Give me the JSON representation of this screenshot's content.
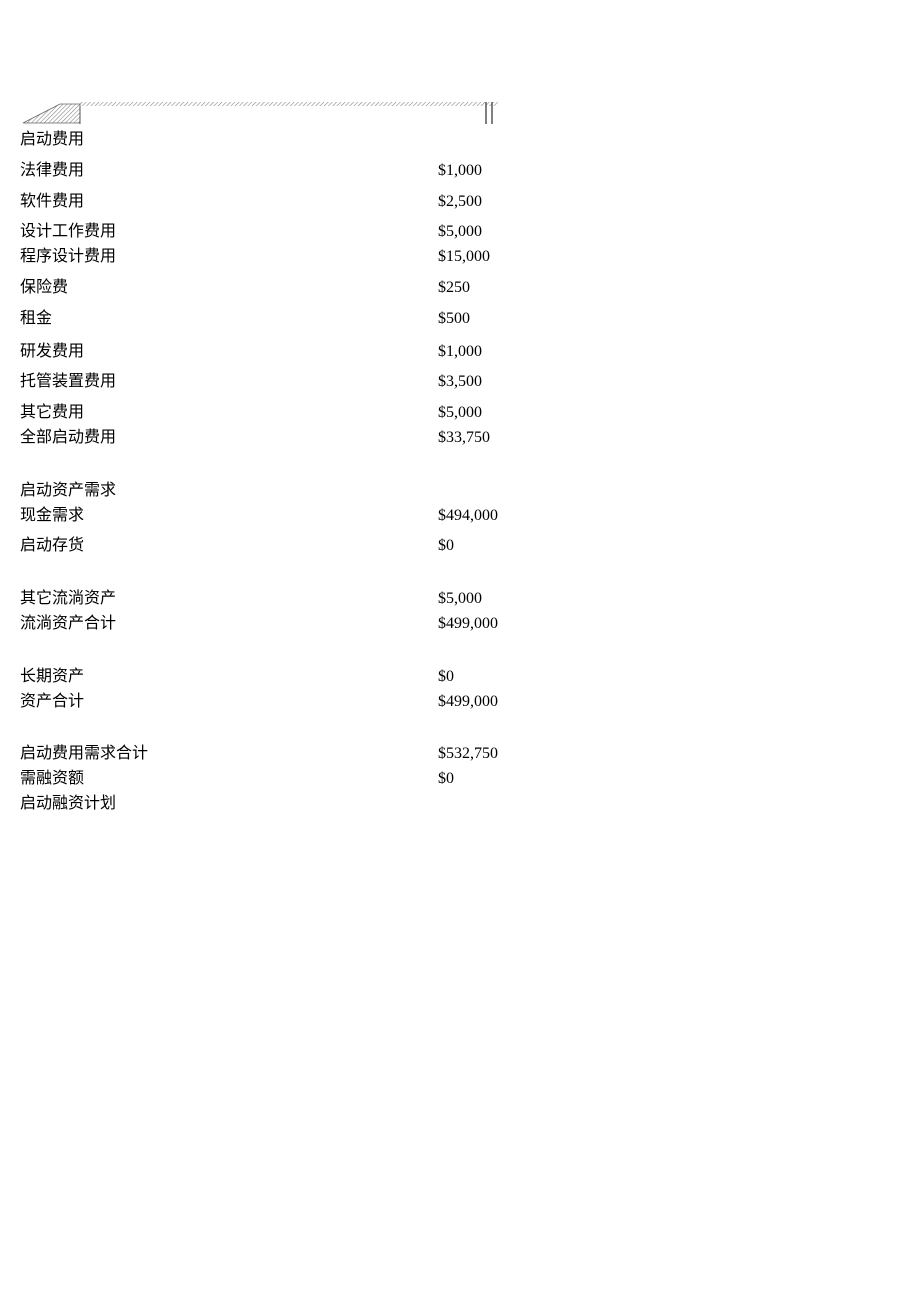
{
  "sections": {
    "startup_expenses": {
      "header": "启动费用",
      "items": [
        {
          "label": "法律费用",
          "value": "$1,000"
        },
        {
          "label": "软件费用",
          "value": "$2,500"
        },
        {
          "label": "设计工作费用",
          "value": "$5,000"
        },
        {
          "label": "程序设计费用",
          "value": "$15,000"
        },
        {
          "label": "保险费",
          "value": "$250"
        },
        {
          "label": "租金",
          "value": "$500"
        },
        {
          "label": "研发费用",
          "value": "$1,000"
        },
        {
          "label": "托管装置费用",
          "value": "$3,500"
        },
        {
          "label": "其它费用",
          "value": "$5,000"
        },
        {
          "label": "全部启动费用",
          "value": "$33,750"
        }
      ]
    },
    "startup_assets": {
      "header": "启动资产需求",
      "items": [
        {
          "label": "现金需求",
          "value": "$494,000"
        },
        {
          "label": "启动存货",
          "value": "$0"
        }
      ]
    },
    "current_assets": {
      "items": [
        {
          "label": "其它流淌资产",
          "value": "$5,000"
        },
        {
          "label": "流淌资产合计",
          "value": "$499,000"
        }
      ]
    },
    "long_term_assets": {
      "items": [
        {
          "label": "长期资产",
          "value": "$0"
        },
        {
          "label": "资产合计",
          "value": "$499,000"
        }
      ]
    },
    "totals": {
      "items": [
        {
          "label": "启动费用需求合计",
          "value": "$532,750"
        },
        {
          "label": "需融资额",
          "value": "$0"
        },
        {
          "label": "启动融资计划",
          "value": ""
        }
      ]
    }
  }
}
